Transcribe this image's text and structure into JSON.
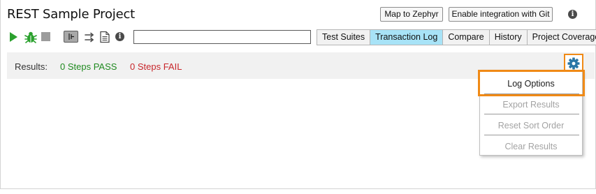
{
  "header": {
    "title": "REST Sample Project",
    "map_to_zephyr": "Map to Zephyr",
    "enable_git": "Enable integration with Git",
    "info_glyph": "i"
  },
  "toolbar": {
    "icons": [
      "play-icon",
      "bug-icon",
      "stop-icon",
      "toggle-icon",
      "transfer-icon",
      "document-icon",
      "info-icon"
    ],
    "info_glyph": "i",
    "search_value": ""
  },
  "tabs": [
    {
      "label": "Test Suites",
      "active": false
    },
    {
      "label": "Transaction Log",
      "active": true
    },
    {
      "label": "Compare",
      "active": false
    },
    {
      "label": "History",
      "active": false
    },
    {
      "label": "Project Coverage",
      "active": false
    }
  ],
  "results": {
    "label": "Results:",
    "pass": "0 Steps PASS",
    "fail": "0 Steps FAIL"
  },
  "menu": {
    "items": [
      {
        "label": "Log Options",
        "enabled": true,
        "highlighted": true
      },
      {
        "label": "Export Results",
        "enabled": false
      },
      {
        "label": "Reset Sort Order",
        "enabled": false
      },
      {
        "label": "Clear Results",
        "enabled": false
      }
    ]
  },
  "colors": {
    "accent_highlight": "#f08a16",
    "active_tab": "#a8e3f7",
    "pass": "#1f8a1f",
    "fail": "#c8262b",
    "gear": "#2a76a6"
  }
}
